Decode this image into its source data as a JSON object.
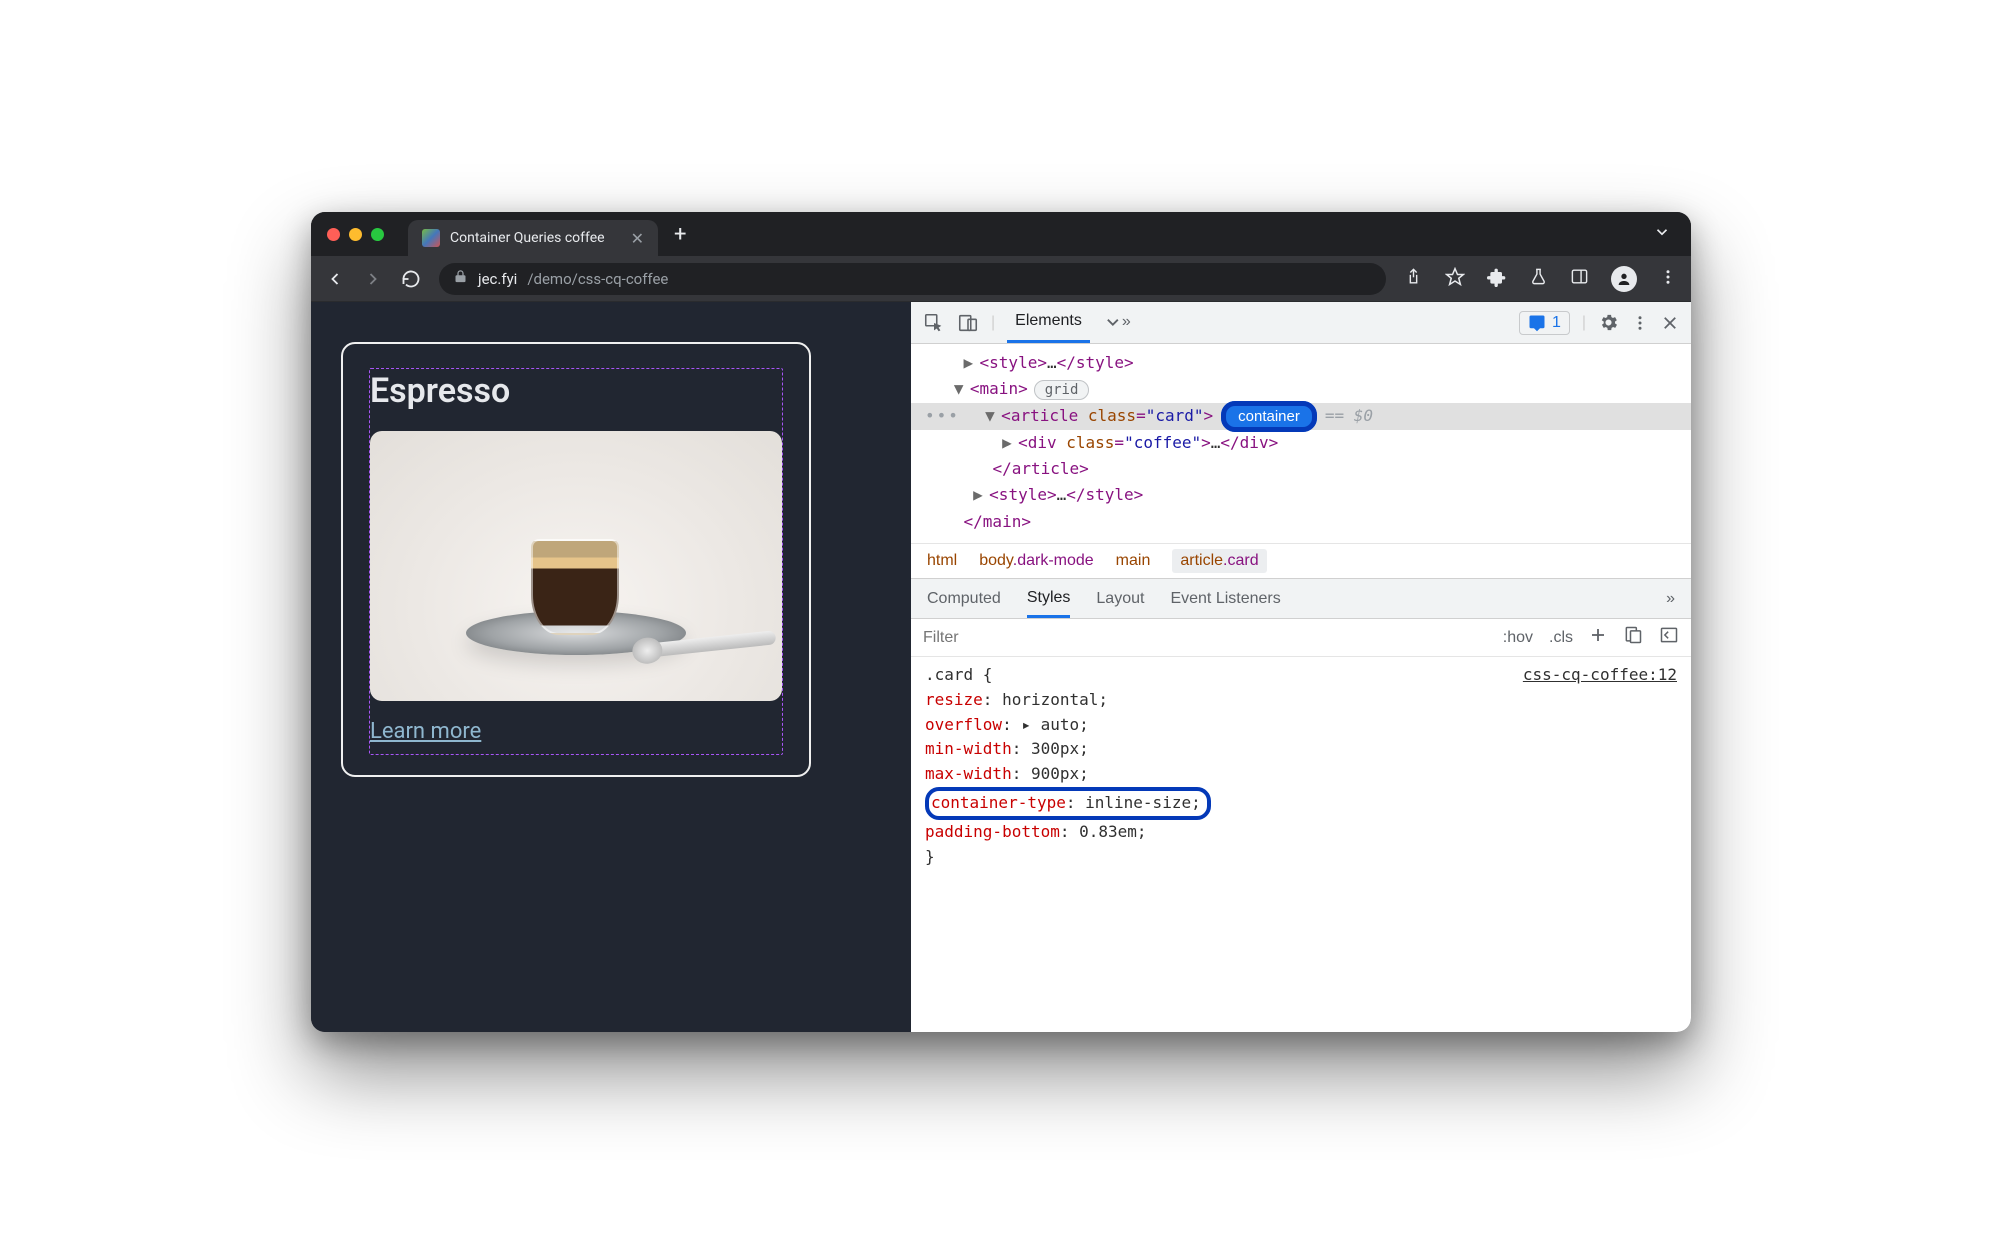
{
  "window": {
    "tab_title": "Container Queries coffee",
    "url_host": "jec.fyi",
    "url_path": "/demo/css-cq-coffee"
  },
  "page": {
    "card_title": "Espresso",
    "link_text": "Learn more"
  },
  "devtools": {
    "toolbar": {
      "panel_elements": "Elements",
      "issues_count": "1"
    },
    "dom": {
      "style_open": "<style>",
      "style_ellipsis": "…",
      "style_close": "</style>",
      "main_open": "<main>",
      "main_badge": "grid",
      "article_open_tag": "article",
      "article_attr_name": "class",
      "article_attr_value": "\"card\"",
      "container_badge": "container",
      "eq_dollar": "== $0",
      "div_open_tag": "div",
      "div_attr_name": "class",
      "div_attr_value": "\"coffee\"",
      "div_close": "</div>",
      "article_close": "</article>",
      "main_close": "</main>"
    },
    "breadcrumb": {
      "b0": "html",
      "b1_el": "body",
      "b1_cls": ".dark-mode",
      "b2": "main",
      "b3_el": "article",
      "b3_cls": ".card"
    },
    "styles_tabs": {
      "computed": "Computed",
      "styles": "Styles",
      "layout": "Layout",
      "event": "Event Listeners"
    },
    "filter": {
      "placeholder": "Filter",
      "hov": ":hov",
      "cls": ".cls"
    },
    "rule": {
      "source": "css-cq-coffee:12",
      "selector": ".card {",
      "p1_n": "resize",
      "p1_v": "horizontal",
      "p2_n": "overflow",
      "p2_v": "auto",
      "p3_n": "min-width",
      "p3_v": "300px",
      "p4_n": "max-width",
      "p4_v": "900px",
      "p5_n": "container-type",
      "p5_v": "inline-size",
      "p6_n": "padding-bottom",
      "p6_v": "0.83em",
      "close": "}"
    }
  }
}
